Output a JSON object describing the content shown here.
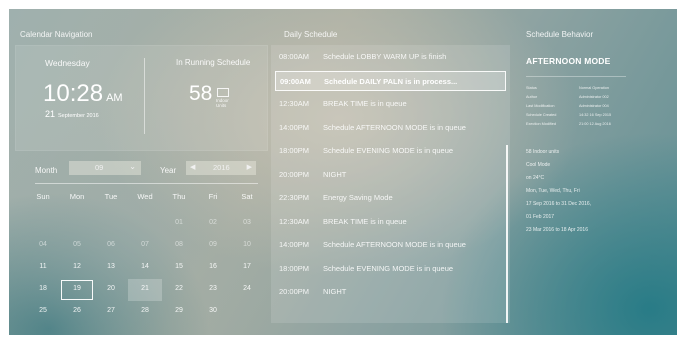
{
  "calendar_navigation": {
    "title": "Calendar Navigation",
    "weekday": "Wednesday",
    "time": "10:28",
    "ampm": "AM",
    "date_day": "21",
    "date_rest": "September 2016",
    "running_label": "In Running Schedule",
    "running_count": "58",
    "running_unit": "Indoor Units",
    "month_label": "Month",
    "month_value": "09",
    "year_label": "Year",
    "year_value": "2016",
    "weekdays": [
      "Sun",
      "Mon",
      "Tue",
      "Wed",
      "Thu",
      "Fri",
      "Sat"
    ],
    "weeks": [
      [
        "",
        "",
        "",
        "",
        "01",
        "02",
        "03"
      ],
      [
        "04",
        "05",
        "06",
        "07",
        "08",
        "09",
        "10"
      ],
      [
        "11",
        "12",
        "13",
        "14",
        "15",
        "16",
        "17"
      ],
      [
        "18",
        "19",
        "20",
        "21",
        "22",
        "23",
        "24"
      ],
      [
        "25",
        "26",
        "27",
        "28",
        "29",
        "30",
        ""
      ]
    ],
    "selected_day": "19",
    "today": "21"
  },
  "daily_schedule": {
    "title": "Daily Schedule",
    "items": [
      {
        "time": "08:00AM",
        "text": "Schedule LOBBY WARM UP is finish"
      },
      {
        "time": "09:00AM",
        "text": "Schedule DAILY PALN is in process...",
        "active": true
      },
      {
        "time": "12:30AM",
        "text": "BREAK TIME is in queue"
      },
      {
        "time": "14:00PM",
        "text": "Schedule AFTERNOON MODE is in queue"
      },
      {
        "time": "18:00PM",
        "text": "Schedule EVENING MODE is in queue"
      },
      {
        "time": "20:00PM",
        "text": "NIGHT"
      },
      {
        "time": "22:30PM",
        "text": "Energy Saving Mode"
      },
      {
        "time": "12:30AM",
        "text": "BREAK TIME is in queue"
      },
      {
        "time": "14:00PM",
        "text": "Schedule AFTERNOON MODE is in queue"
      },
      {
        "time": "18:00PM",
        "text": "Schedule EVENING MODE is in queue"
      },
      {
        "time": "20:00PM",
        "text": "NIGHT"
      }
    ]
  },
  "schedule_behavior": {
    "title": "Schedule Behavior",
    "mode": "AFTERNOON MODE",
    "fields": [
      {
        "key": "Status",
        "value": "Normal Operation"
      },
      {
        "key": "Author",
        "value": "Administrator 002"
      },
      {
        "key": "Last Modification",
        "value": "Administrator 004"
      },
      {
        "key": "Schedule Created",
        "value": "14:32 16 Sep 2015"
      },
      {
        "key": "Exection Modified",
        "value": "21:00 12 Aug 2016"
      }
    ],
    "details": [
      "58 Indoor units",
      "Cool Mode",
      "on 24°C",
      "Mon, Tue, Wed, Thu, Fri",
      "17 Sep 2016 to 31 Dec 2016,",
      "01 Feb 2017",
      "23 Mar 2016 to 18 Apr 2016"
    ]
  }
}
